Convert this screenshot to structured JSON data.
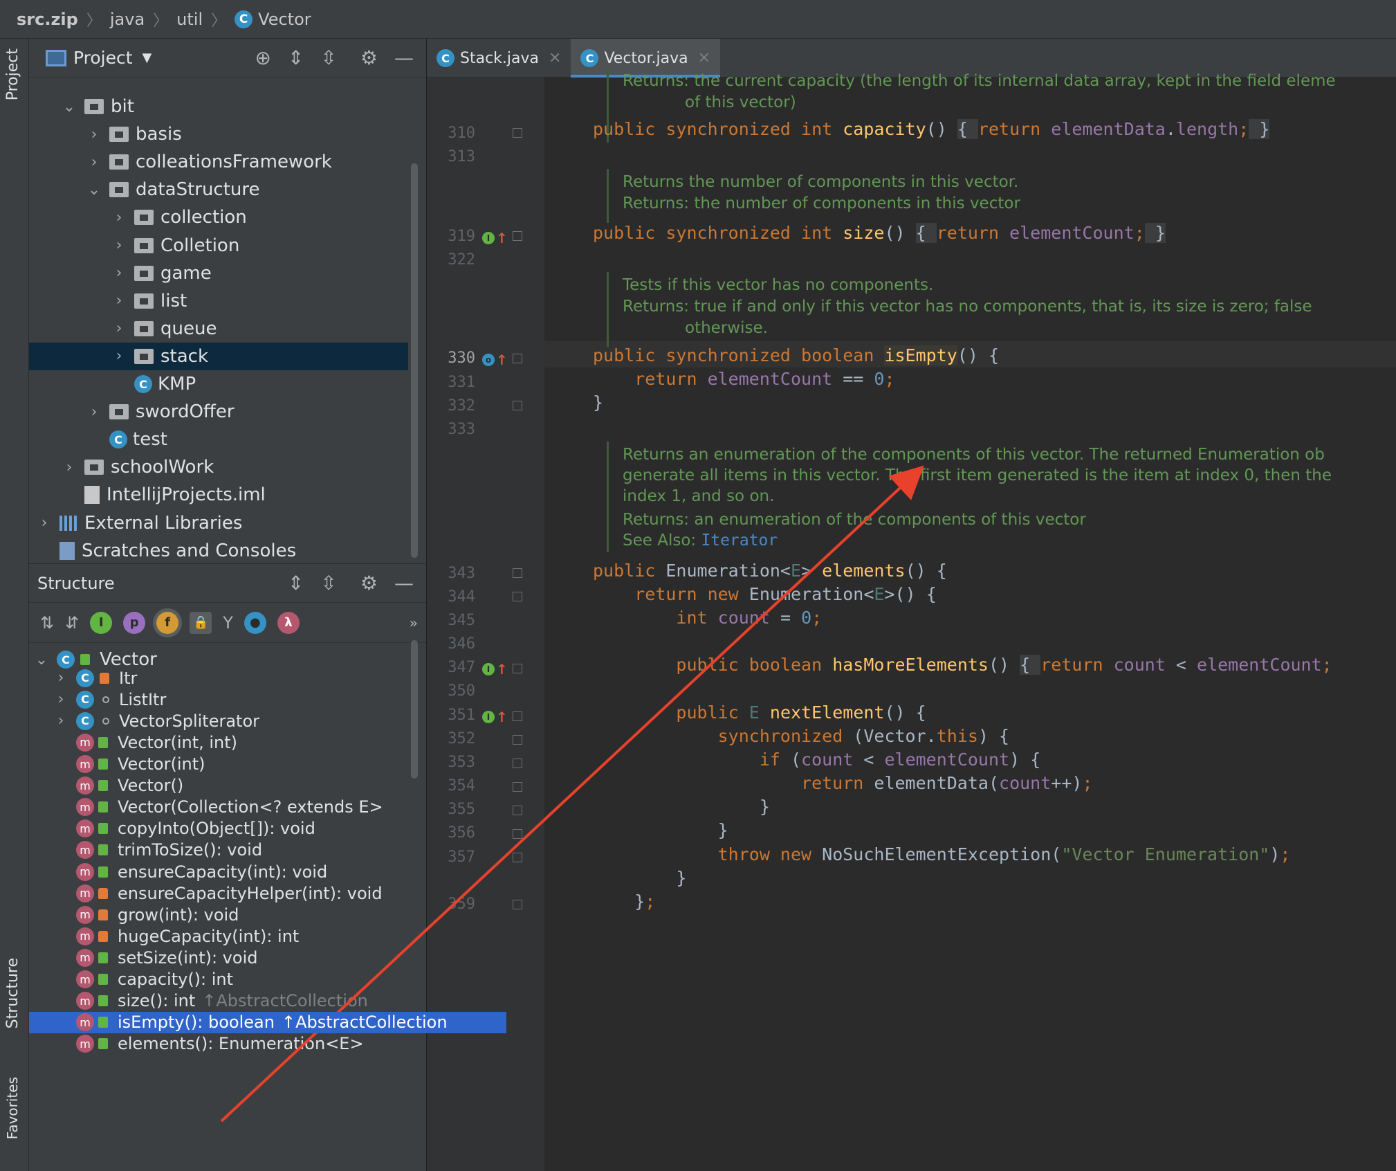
{
  "breadcrumb": [
    "src.zip",
    "java",
    "util",
    "Vector"
  ],
  "project_panel": {
    "title": "Project",
    "tree": [
      {
        "label": "bit",
        "depth": 2,
        "kind": "folder",
        "expanded": true
      },
      {
        "label": "basis",
        "depth": 3,
        "kind": "folder"
      },
      {
        "label": "colleationsFramework",
        "depth": 3,
        "kind": "folder"
      },
      {
        "label": "dataStructure",
        "depth": 3,
        "kind": "folder",
        "expanded": true
      },
      {
        "label": "collection",
        "depth": 4,
        "kind": "folder"
      },
      {
        "label": "Colletion",
        "depth": 4,
        "kind": "folder"
      },
      {
        "label": "game",
        "depth": 4,
        "kind": "folder"
      },
      {
        "label": "list",
        "depth": 4,
        "kind": "folder"
      },
      {
        "label": "queue",
        "depth": 4,
        "kind": "folder"
      },
      {
        "label": "stack",
        "depth": 4,
        "kind": "folder",
        "selected": true
      },
      {
        "label": "KMP",
        "depth": 4,
        "kind": "class"
      },
      {
        "label": "swordOffer",
        "depth": 3,
        "kind": "folder"
      },
      {
        "label": "test",
        "depth": 3,
        "kind": "class"
      },
      {
        "label": "schoolWork",
        "depth": 2,
        "kind": "folder"
      },
      {
        "label": "IntellijProjects.iml",
        "depth": 2,
        "kind": "file"
      },
      {
        "label": "External Libraries",
        "depth": 1,
        "kind": "lib"
      },
      {
        "label": "Scratches and Consoles",
        "depth": 1,
        "kind": "scratch"
      }
    ]
  },
  "structure_panel": {
    "title": "Structure",
    "root": "Vector",
    "items": [
      {
        "label": "Itr",
        "icon": "class",
        "access": "private"
      },
      {
        "label": "ListItr",
        "icon": "class",
        "access": "package"
      },
      {
        "label": "VectorSpliterator",
        "icon": "class",
        "access": "package"
      },
      {
        "label": "Vector(int, int)",
        "icon": "method",
        "access": "public"
      },
      {
        "label": "Vector(int)",
        "icon": "method",
        "access": "public"
      },
      {
        "label": "Vector()",
        "icon": "method",
        "access": "public"
      },
      {
        "label": "Vector(Collection<? extends E>",
        "icon": "method",
        "access": "public"
      },
      {
        "label": "copyInto(Object[]): void",
        "icon": "method",
        "access": "public"
      },
      {
        "label": "trimToSize(): void",
        "icon": "method",
        "access": "public"
      },
      {
        "label": "ensureCapacity(int): void",
        "icon": "method",
        "access": "public"
      },
      {
        "label": "ensureCapacityHelper(int): void",
        "icon": "method",
        "access": "private"
      },
      {
        "label": "grow(int): void",
        "icon": "method",
        "access": "private"
      },
      {
        "label": "hugeCapacity(int): int",
        "icon": "method",
        "access": "private"
      },
      {
        "label": "setSize(int): void",
        "icon": "method",
        "access": "public"
      },
      {
        "label": "capacity(): int",
        "icon": "method",
        "access": "public"
      },
      {
        "label": "size(): int",
        "icon": "method",
        "access": "public",
        "inherited": "↑AbstractCollection"
      },
      {
        "label": "isEmpty(): boolean",
        "icon": "method",
        "access": "public",
        "inherited": "↑AbstractCollection",
        "selected": true
      },
      {
        "label": "elements(): Enumeration<E>",
        "icon": "method",
        "access": "public"
      }
    ]
  },
  "tool_windows": {
    "project": "Project",
    "structure": "Structure",
    "favorites": "Favorites"
  },
  "tabs": [
    {
      "label": "Stack.java",
      "active": false
    },
    {
      "label": "Vector.java",
      "active": true
    }
  ],
  "editor": {
    "lines": [
      "310",
      "313",
      "319",
      "322",
      "330",
      "331",
      "332",
      "333",
      "343",
      "344",
      "345",
      "346",
      "347",
      "350",
      "351",
      "352",
      "353",
      "354",
      "355",
      "356",
      "357",
      "359"
    ],
    "docs": {
      "d1_l1": "Returns: the current capacity (the length of its internal data array, kept in the field eleme",
      "d1_l2": "of this vector)",
      "d2_l1": "Returns the number of components in this vector.",
      "d2_l2": "Returns: the number of components in this vector",
      "d3_l1": "Tests if this vector has no components.",
      "d3_l2": "Returns: true if and only if this vector has no components, that is, its size is zero; false",
      "d3_l3": "otherwise.",
      "d4_l1": "Returns an enumeration of the components of this vector. The returned Enumeration ob",
      "d4_l2": "generate all items in this vector. The first item generated is the item at index 0, then the",
      "d4_l3": "index 1, and so on.",
      "d4_l4": "Returns:  an enumeration of the components of this vector",
      "d4_see": "See Also:",
      "d4_link": "Iterator"
    }
  },
  "colors": {
    "accent": "#4a88c7",
    "selection": "#2f65ca",
    "arrow": "#e8412c"
  }
}
